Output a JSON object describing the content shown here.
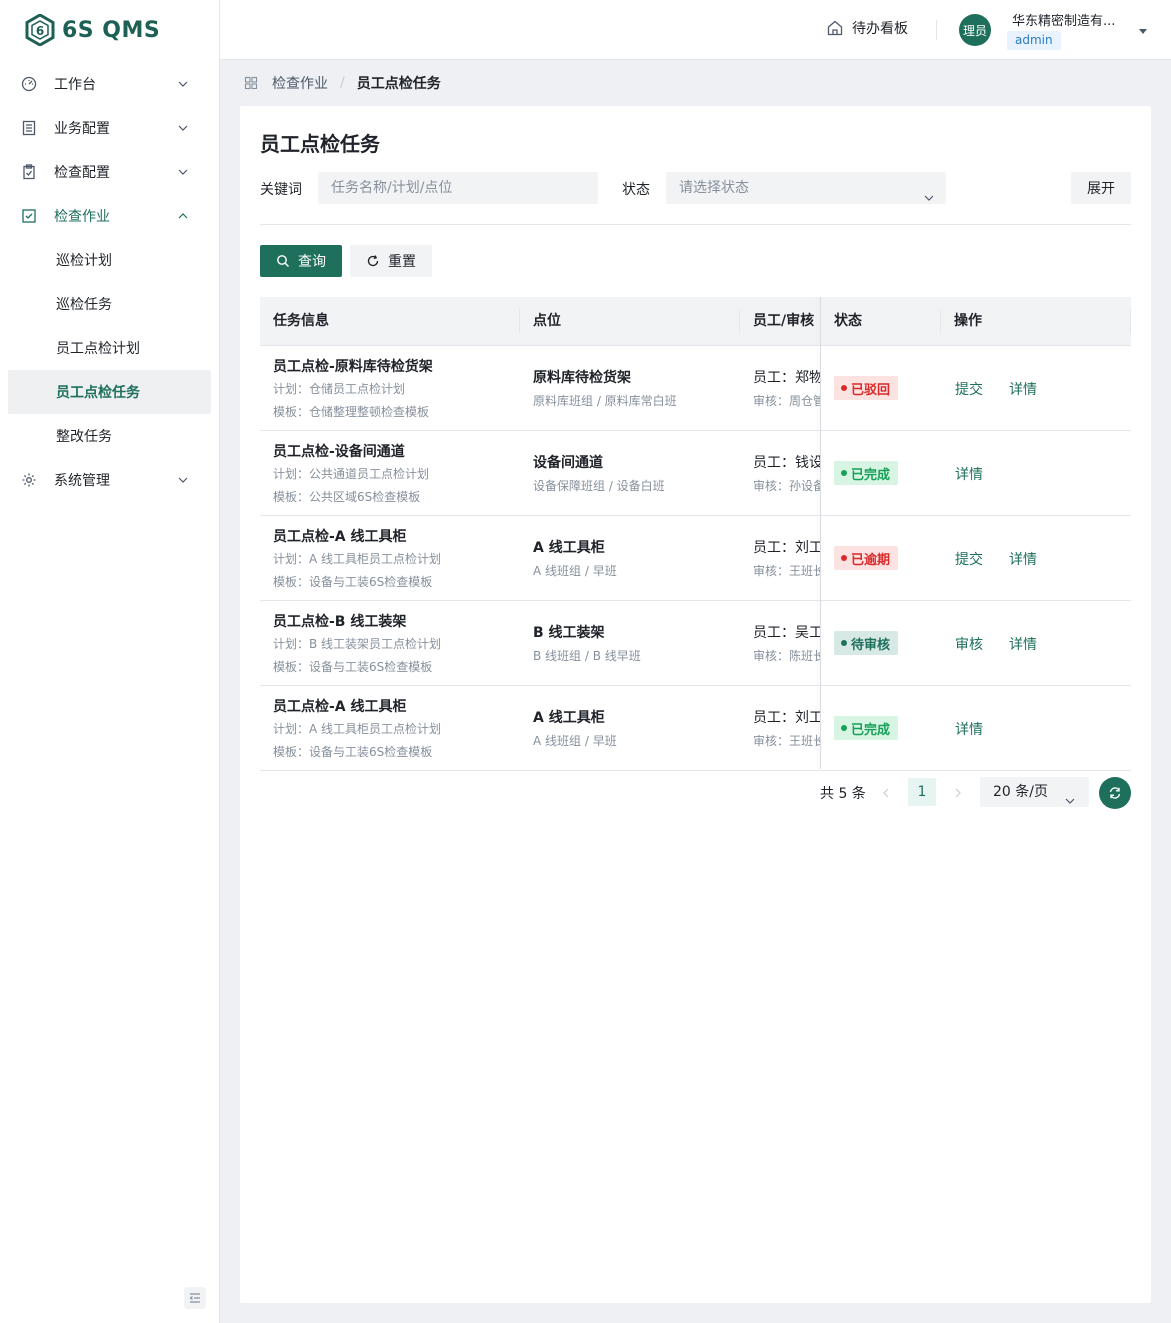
{
  "app": {
    "logo_text": "6S QMS"
  },
  "sidebar": {
    "items": [
      {
        "label": "工作台",
        "icon": "dashboard-icon"
      },
      {
        "label": "业务配置",
        "icon": "business-config-icon"
      },
      {
        "label": "检查配置",
        "icon": "check-config-icon"
      },
      {
        "label": "检查作业",
        "icon": "check-job-icon"
      },
      {
        "label": "系统管理",
        "icon": "gear-icon"
      }
    ],
    "sub_items": [
      "巡检计划",
      "巡检任务",
      "员工点检计划",
      "员工点检任务",
      "整改任务"
    ],
    "active_sub": "员工点检任务"
  },
  "header": {
    "todo_label": "待办看板",
    "avatar_text": "理员",
    "user_name": "华东精密制造有...",
    "user_role": "admin"
  },
  "breadcrumb": {
    "parent": "检查作业",
    "current": "员工点检任务"
  },
  "page": {
    "title": "员工点检任务",
    "filters": {
      "keyword_label": "关键词",
      "keyword_placeholder": "任务名称/计划/点位",
      "status_label": "状态",
      "status_placeholder": "请选择状态",
      "expand_label": "展开"
    },
    "buttons": {
      "query": "查询",
      "reset": "重置"
    }
  },
  "table": {
    "columns": [
      "任务信息",
      "点位",
      "员工/审核",
      "状态",
      "操作"
    ],
    "rows": [
      {
        "title": "员工点检-原料库待检货架",
        "plan": "计划：仓储员工点检计划",
        "template": "模板：仓储整理整顿检查模板",
        "point": "原料库待检货架",
        "point_sub": "原料库班组 / 原料库常白班",
        "employee": "员工：郑物",
        "auditor": "审核：周仓管",
        "status": "已驳回",
        "status_color": "#d92a2a",
        "actions": [
          "提交",
          "详情"
        ]
      },
      {
        "title": "员工点检-设备间通道",
        "plan": "计划：公共通道员工点检计划",
        "template": "模板：公共区域6S检查模板",
        "point": "设备间通道",
        "point_sub": "设备保障班组 / 设备白班",
        "employee": "员工：钱设",
        "auditor": "审核：孙设备",
        "status": "已完成",
        "status_color": "#18a058",
        "actions": [
          "详情"
        ]
      },
      {
        "title": "员工点检-A 线工具柜",
        "plan": "计划：A 线工具柜员工点检计划",
        "template": "模板：设备与工装6S检查模板",
        "point": "A 线工具柜",
        "point_sub": "A 线班组 / 早班",
        "employee": "员工：刘工",
        "auditor": "审核：王班长",
        "status": "已逾期",
        "status_color": "#d92a2a",
        "actions": [
          "提交",
          "详情"
        ]
      },
      {
        "title": "员工点检-B 线工装架",
        "plan": "计划：B 线工装架员工点检计划",
        "template": "模板：设备与工装6S检查模板",
        "point": "B 线工装架",
        "point_sub": "B 线班组 / B 线早班",
        "employee": "员工：吴工",
        "auditor": "审核：陈班长",
        "status": "待审核",
        "status_color": "#1e6f5c",
        "actions": [
          "审核",
          "详情"
        ]
      },
      {
        "title": "员工点检-A 线工具柜",
        "plan": "计划：A 线工具柜员工点检计划",
        "template": "模板：设备与工装6S检查模板",
        "point": "A 线工具柜",
        "point_sub": "A 线班组 / 早班",
        "employee": "员工：刘工",
        "auditor": "审核：王班长",
        "status": "已完成",
        "status_color": "#18a058",
        "actions": [
          "详情"
        ]
      }
    ]
  },
  "pagination": {
    "total": "共 5 条",
    "current_page": "1",
    "page_size": "20 条/页"
  },
  "colors": {
    "primary": "#1e6f5c",
    "danger": "#d92a2a",
    "success": "#18a058"
  }
}
